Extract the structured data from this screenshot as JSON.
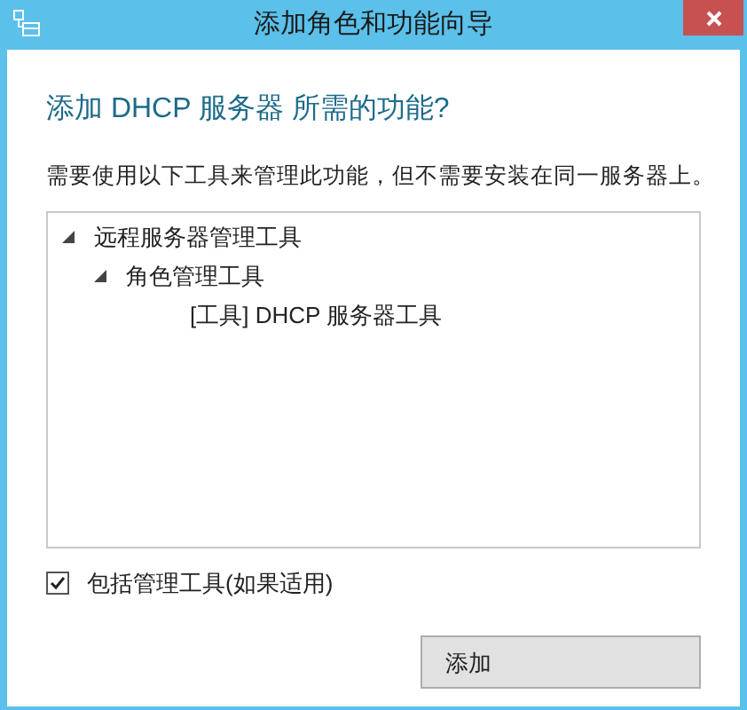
{
  "window": {
    "title": "添加角色和功能向导"
  },
  "heading": "添加 DHCP 服务器 所需的功能?",
  "description": "需要使用以下工具来管理此功能，但不需要安装在同一服务器上。",
  "tree": [
    {
      "label": "远程服务器管理工具",
      "expanded": true,
      "children": [
        {
          "label": "角色管理工具",
          "expanded": true,
          "children": [
            {
              "label": "[工具] DHCP 服务器工具"
            }
          ]
        }
      ]
    }
  ],
  "include_tools": {
    "label": "包括管理工具(如果适用)",
    "checked": true
  },
  "buttons": [
    "添加"
  ]
}
